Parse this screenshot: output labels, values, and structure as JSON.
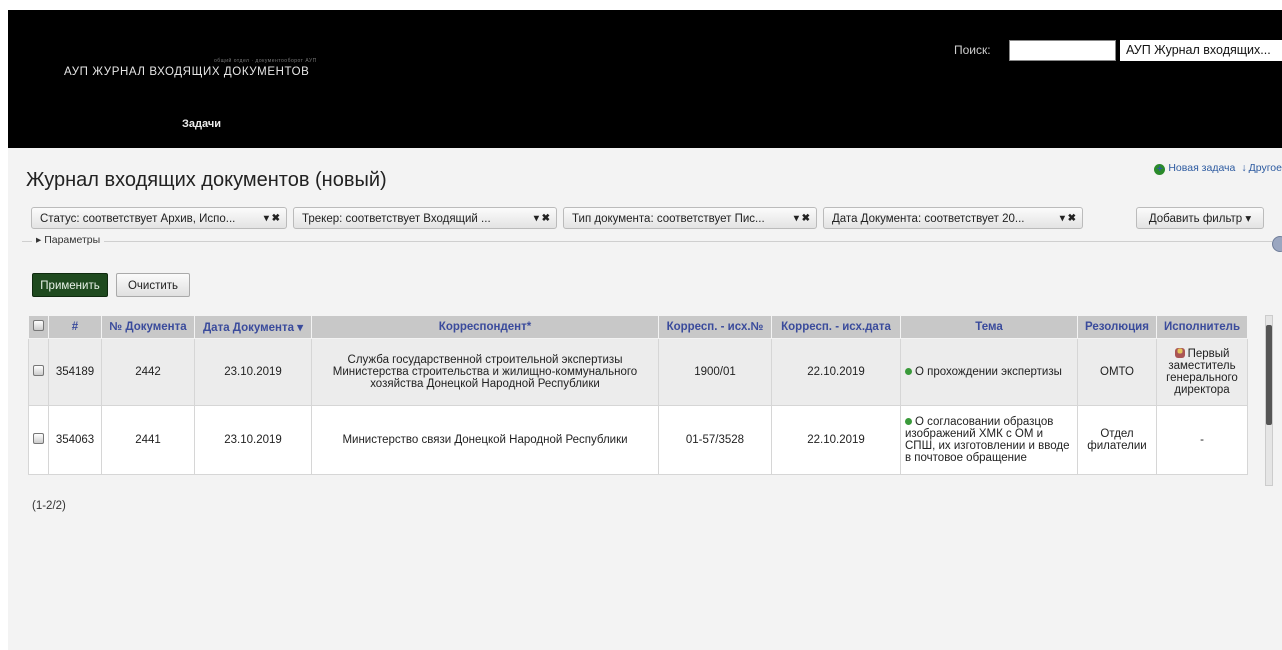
{
  "header": {
    "logo_small": "общий отдел · документооборот АУП",
    "logo_title": "АУП ЖУРНАЛ ВХОДЯЩИХ ДОКУМЕНТОВ",
    "nav_tasks": "Задачи",
    "search_label": "Поиск:",
    "search_value": "",
    "project_select": "АУП Журнал входящих...",
    "colors": {
      "background": "#000000"
    }
  },
  "page": {
    "title": "Журнал входящих документов (новый)",
    "new_task": "Новая задача",
    "other": "Другое"
  },
  "filters": [
    {
      "label": "Статус: соответствует Архив, Испо..."
    },
    {
      "label": "Трекер: соответствует Входящий ..."
    },
    {
      "label": "Тип документа: соответствует Пис..."
    },
    {
      "label": "Дата Документа: соответствует 20..."
    }
  ],
  "filter_controls": "▾ ✖",
  "add_filter": "Добавить фильтр ▾",
  "params_label": "▸ Параметры",
  "buttons": {
    "apply": "Применить",
    "clear": "Очистить"
  },
  "table": {
    "headers": [
      "#",
      "№ Документа",
      "Дата Документа ▾",
      "Корреспондент*",
      "Корресп. - исх.№",
      "Корресп. - исх.дата",
      "Тема",
      "Резолюция",
      "Исполнитель"
    ],
    "rows": [
      {
        "id": "354189",
        "doc_no": "2442",
        "doc_date": "23.10.2019",
        "correspondent": "Служба государственной строительной экспертизы Министерства строительства и жилищно-коммунального хозяйства Донецкой Народной Республики",
        "out_no": "1900/01",
        "out_date": "22.10.2019",
        "topic": "О прохождении экспертизы",
        "resolution": "ОМТО",
        "assignee": "Первый заместитель генерального директора"
      },
      {
        "id": "354063",
        "doc_no": "2441",
        "doc_date": "23.10.2019",
        "correspondent": "Министерство связи Донецкой Народной Республики",
        "out_no": "01-57/3528",
        "out_date": "22.10.2019",
        "topic": "О согласовании образцов изображений ХМК с ОМ и СПШ, их изготовлении и вводе в почтовое обращение",
        "resolution": "Отдел филателии",
        "assignee": "-"
      }
    ]
  },
  "count": "(1-2/2)"
}
